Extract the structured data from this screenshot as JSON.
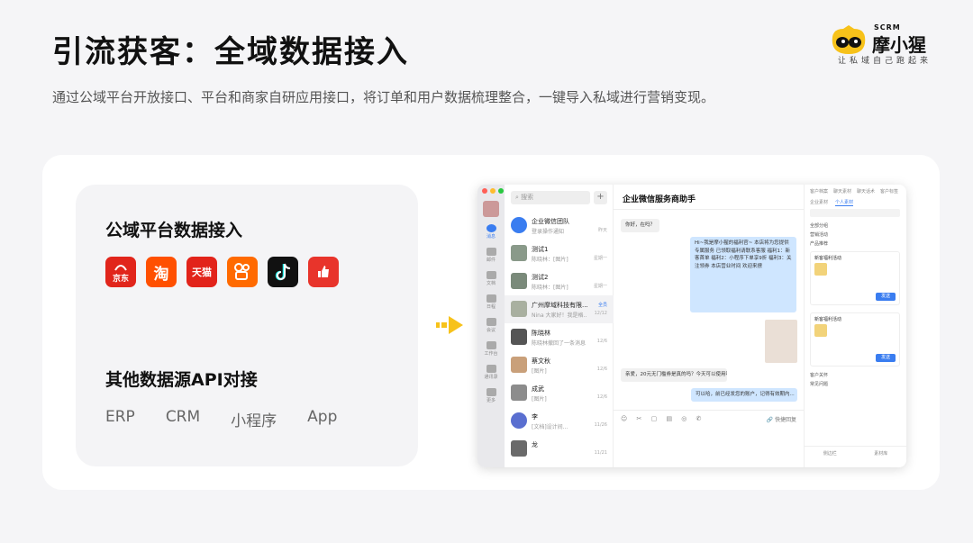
{
  "header": {
    "title": "引流获客：全域数据接入",
    "subtitle": "通过公域平台开放接口、平台和商家自研应用接口，将订单和用户数据梳理整合，一键导入私域进行营销变现。"
  },
  "logo": {
    "scrm": "SCRM",
    "name": "摩小猩",
    "tagline": "让私域自己跑起来"
  },
  "left_panel": {
    "public_title": "公域平台数据接入",
    "platforms": [
      {
        "name": "jd-icon",
        "label": "京东",
        "color": "#e1251b"
      },
      {
        "name": "taobao-icon",
        "label": "淘",
        "color": "#ff5000"
      },
      {
        "name": "tmall-icon",
        "label": "天猫",
        "color": "#e2231a"
      },
      {
        "name": "kuaishou-icon",
        "label": "",
        "color": "#ff6a00"
      },
      {
        "name": "douyin-icon",
        "label": "",
        "color": "#111111"
      },
      {
        "name": "thumb-app-icon",
        "label": "",
        "color": "#e8342b"
      }
    ],
    "other_title": "其他数据源API对接",
    "sources": [
      "ERP",
      "CRM",
      "小程序",
      "App"
    ]
  },
  "app_window": {
    "search_placeholder": "搜索",
    "nav": [
      "消息",
      "邮件",
      "文档",
      "日程",
      "会议",
      "工作台",
      "通讯录",
      "更多"
    ],
    "conversations": [
      {
        "name": "企业微信团队",
        "preview": "登录操作通知",
        "time": "昨天",
        "tag": ""
      },
      {
        "name": "测试1",
        "preview": "陈晓林：[图片]",
        "time": "星期一",
        "tag": ""
      },
      {
        "name": "测试2",
        "preview": "陈晓林：[图片]",
        "time": "星期一",
        "tag": ""
      },
      {
        "name": "广州摩域科技有限...",
        "preview": "Nina 大家好！我是格...",
        "time": "12/12",
        "tag": "全员"
      },
      {
        "name": "陈晓林",
        "preview": "陈晓林撤回了一条消息",
        "time": "12/6",
        "tag": ""
      },
      {
        "name": "蔡文秋",
        "preview": "[图片]",
        "time": "12/6",
        "tag": ""
      },
      {
        "name": "成武",
        "preview": "[图片]",
        "time": "12/6",
        "tag": ""
      },
      {
        "name": "李",
        "preview": "[文档]设计间...",
        "time": "11/26",
        "tag": ""
      },
      {
        "name": "龙",
        "preview": "",
        "time": "11/21",
        "tag": ""
      }
    ],
    "chat": {
      "title": "企业微信服务商助手",
      "messages": [
        "你好，在吗？",
        "Hi~我是摩小猩的福利官~ 本店将为您提供专属服务 已领取福利请联系客服 福利1：新客首单 福利2：小程序下单享9折 福利3：关注领券 本店营业时间 欢迎来撩",
        "亲爱，20元无门槛券是真的吗？今天可以使用吗？",
        "可以哈，前已经发您的账户，记得有效期内..."
      ],
      "quick_reply": "快捷回复"
    },
    "right": {
      "tabs": [
        "客户档案",
        "聊天素材",
        "聊天话术",
        "客户标签"
      ],
      "subtabs": [
        "企业素材",
        "个人素材"
      ],
      "lines": [
        "全部分组",
        "营销活动",
        "产品推荐",
        "客户关怀",
        "常见问题"
      ],
      "card_title": "新客福利活动",
      "card_button": "发送",
      "footer": [
        "侧边栏",
        "素材库"
      ]
    }
  }
}
